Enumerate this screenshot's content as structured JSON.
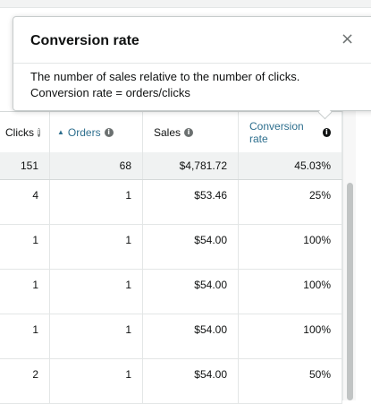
{
  "popover": {
    "title": "Conversion rate",
    "line1": "The number of sales relative to the number of clicks.",
    "line2": "Conversion rate = orders/clicks",
    "close_icon": "close-icon",
    "close_glyph": "×"
  },
  "table": {
    "headers": {
      "clicks": "Clicks",
      "orders": "Orders",
      "sales": "Sales",
      "conversion_rate": "Conversion rate"
    },
    "info_glyph": "i",
    "sort_glyph": "▲",
    "totals": {
      "clicks": "151",
      "orders": "68",
      "sales": "$4,781.72",
      "conversion_rate": "45.03%"
    },
    "rows": [
      {
        "clicks": "4",
        "orders": "1",
        "sales": "$53.46",
        "conversion_rate": "25%"
      },
      {
        "clicks": "1",
        "orders": "1",
        "sales": "$54.00",
        "conversion_rate": "100%"
      },
      {
        "clicks": "1",
        "orders": "1",
        "sales": "$54.00",
        "conversion_rate": "100%"
      },
      {
        "clicks": "1",
        "orders": "1",
        "sales": "$54.00",
        "conversion_rate": "100%"
      },
      {
        "clicks": "2",
        "orders": "1",
        "sales": "$54.00",
        "conversion_rate": "50%"
      }
    ]
  },
  "colors": {
    "link": "#2e6f8e",
    "total_row_bg": "#f0f2f2",
    "border": "#d5d9d9"
  }
}
